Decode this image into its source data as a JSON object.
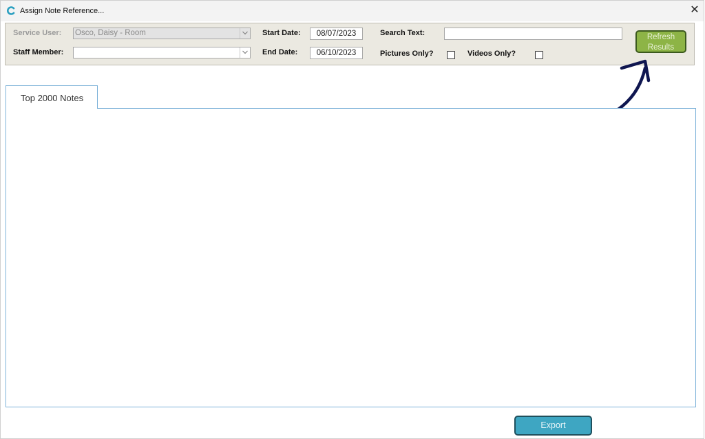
{
  "window": {
    "title": "Assign Note Reference...",
    "app_icon": "app-c-logo-icon",
    "close_icon": "close-icon",
    "close_glyph": "✕"
  },
  "filters": {
    "service_user_label": "Service User:",
    "service_user_value": "Osco, Daisy - Room",
    "staff_member_label": "Staff Member:",
    "staff_member_value": "",
    "start_date_label": "Start Date:",
    "start_date_value": "08/07/2023",
    "end_date_label": "End Date:",
    "end_date_value": "06/10/2023",
    "search_text_label": "Search Text:",
    "search_text_value": "",
    "pictures_only_label": "Pictures Only?",
    "pictures_only_checked": false,
    "videos_only_label": "Videos Only?",
    "videos_only_checked": false,
    "refresh_line1": "Refresh",
    "refresh_line2": "Results"
  },
  "tabs": [
    {
      "label": "Top 2000 Notes",
      "active": true
    }
  ],
  "footer": {
    "export_label": "Export"
  },
  "colors": {
    "refresh_bg": "#8db446",
    "export_bg": "#3ea6c2",
    "annotation_arrow": "#0f1650",
    "panel_bg": "#ebe9e1"
  },
  "annotation": {
    "arrow_icon": "curved-arrow-annotation-icon"
  }
}
